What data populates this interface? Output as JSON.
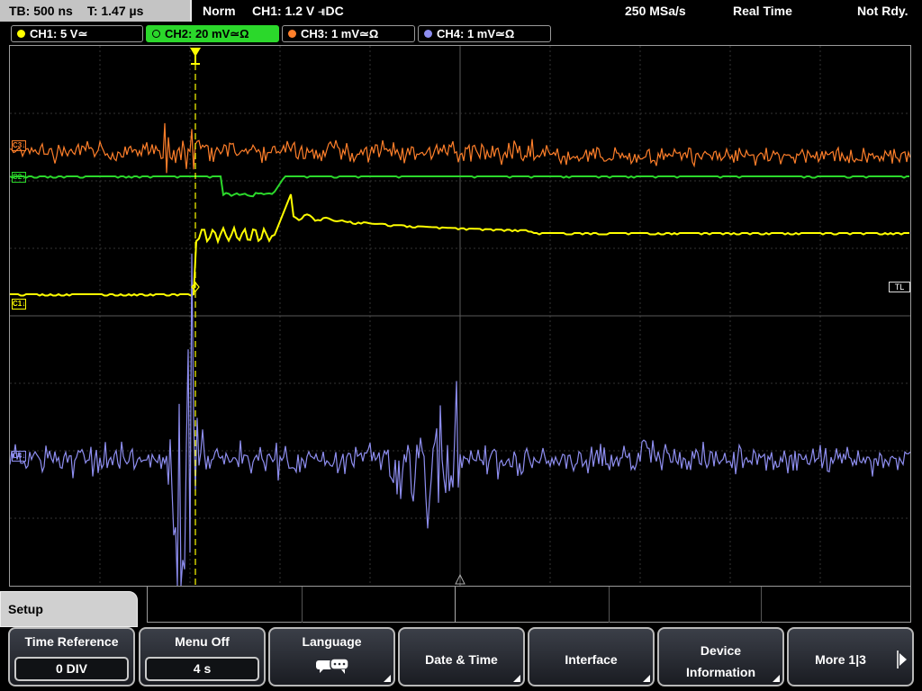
{
  "status_bar": {
    "timebase": "TB: 500 ns",
    "trigger_time": "T: 1.47 µs",
    "trigger_mode": "Norm",
    "trigger_info": "CH1: 1.2 V ⫣DC",
    "sample_rate": "250 MSa/s",
    "acq_mode": "Real Time",
    "status": "Not Rdy."
  },
  "channels": [
    {
      "label": "CH1: 5 V≃",
      "color": "#ffff00"
    },
    {
      "label": "CH2: 20 mV≃Ω",
      "color": "#2bd82b",
      "active": true
    },
    {
      "label": "CH3: 1 mV≃Ω",
      "color": "#ff7f2a"
    },
    {
      "label": "CH4: 1 mV≃Ω",
      "color": "#8e8ef0"
    }
  ],
  "markers": {
    "c3": "C3↓",
    "c2": "C2↓",
    "c1": "C1↓",
    "c4": "C4↓",
    "trigger_level": "TL"
  },
  "menu": {
    "title": "Setup",
    "softkeys": [
      {
        "label": "Time Reference",
        "value": "0 DIV"
      },
      {
        "label": "Menu Off",
        "value": "4 s"
      },
      {
        "label": "Language"
      },
      {
        "label": "Date & Time"
      },
      {
        "label": "Interface"
      },
      {
        "label": "Device Information"
      },
      {
        "label": "More 1|3"
      }
    ]
  },
  "colors": {
    "ch1": "#ffff00",
    "ch2": "#2bd82b",
    "ch3": "#ff7f2a",
    "ch4": "#8e8ef0",
    "grid": "#3a3a3a"
  }
}
